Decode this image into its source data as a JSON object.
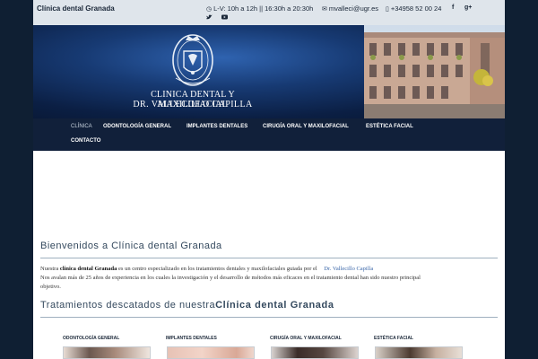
{
  "topbar": {
    "site_name": "Clínica dental Granada",
    "hours": "L-V: 10h a 12h || 16:30h a 20:30h",
    "email": "mvalleci@ugr.es",
    "phone": "+34958 52 00 24",
    "social": [
      "facebook",
      "google-plus",
      "twitter",
      "youtube"
    ]
  },
  "header": {
    "title": "CLINICA DENTAL Y MAXILOFACIAL",
    "subtitle": "DR. VALLECILLO CAPILLA"
  },
  "nav": {
    "items": [
      {
        "label": "CLÍNICA"
      },
      {
        "label": "ODONTOLOGÍA GENERAL"
      },
      {
        "label": "IMPLANTES DENTALES"
      },
      {
        "label": "CIRUGÍA ORAL Y MAXILOFACIAL"
      },
      {
        "label": "ESTÉTICA FACIAL"
      },
      {
        "label": "CONTACTO"
      }
    ]
  },
  "main": {
    "welcome": "Bienvenidos a Clínica dental Granada",
    "intro": {
      "pre": "Nuestra",
      "bold": "clínica dental Granada",
      "mid": "es un centro especializado en los tratamientos  dentales y maxilofaciales guiada por el",
      "link": "Dr. Vallecillo Capilla",
      "line2": "Nos avalan más de 25 años de experiencia en los cuales la investigación y el desarrollo de métodos más eficaces en el tratamiento dental han sido nuestro principal",
      "line3": "objetivo."
    },
    "treatments_title": "Tratamientos descatados de nuestra",
    "treatments_title_bold": "Clínica dental Granada",
    "cards": [
      {
        "label": "ODONTOLOGÍA GENERAL"
      },
      {
        "label": "IMPLANTES DENTALES"
      },
      {
        "label": "CIRUGÍA ORAL Y MAXILOFACIAL"
      },
      {
        "label": "ESTÉTICA FACIAL"
      }
    ]
  },
  "colors": {
    "page_bg": "#0f1f33",
    "topbar_bg": "#dfe5eb",
    "nav_bg": "#11203a",
    "heading": "#34495e",
    "link": "#3a66a8"
  }
}
